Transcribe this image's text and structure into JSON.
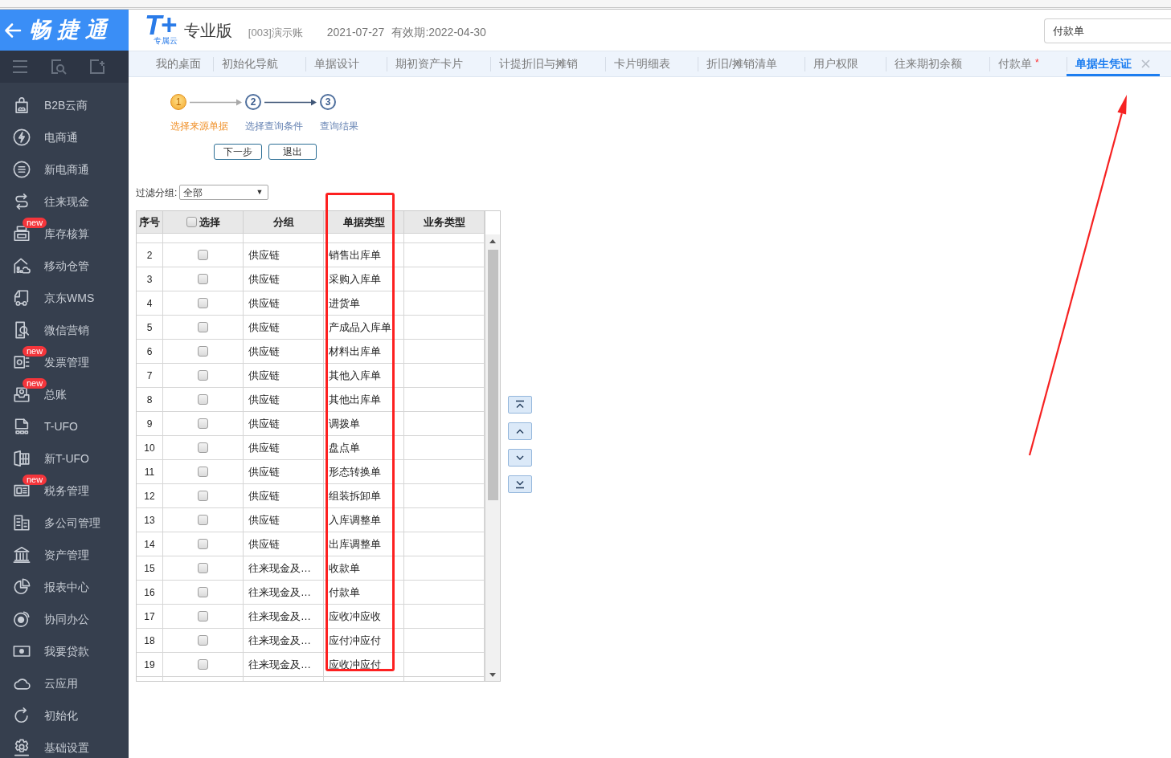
{
  "sidebar": {
    "brand": "畅捷通",
    "items": [
      {
        "label": "B2B云商"
      },
      {
        "label": "电商通"
      },
      {
        "label": "新电商通"
      },
      {
        "label": "往来现金"
      },
      {
        "label": "库存核算",
        "badge": "new"
      },
      {
        "label": "移动仓管"
      },
      {
        "label": "京东WMS"
      },
      {
        "label": "微信营销"
      },
      {
        "label": "发票管理",
        "badge": "new"
      },
      {
        "label": "总账",
        "badge": "new"
      },
      {
        "label": "T-UFO"
      },
      {
        "label": "新T-UFO"
      },
      {
        "label": "税务管理",
        "badge": "new"
      },
      {
        "label": "多公司管理"
      },
      {
        "label": "资产管理"
      },
      {
        "label": "报表中心"
      },
      {
        "label": "协同办公"
      },
      {
        "label": "我要贷款"
      },
      {
        "label": "云应用"
      },
      {
        "label": "初始化"
      },
      {
        "label": "基础设置"
      }
    ]
  },
  "header": {
    "logo_mark": "T+",
    "logo_sub": "专属云",
    "edition": "专业版",
    "account": "[003]演示账",
    "date": "2021-07-27",
    "validity": "有效期:2022-04-30",
    "search": {
      "value": "付款单"
    }
  },
  "tabs": [
    {
      "label": "我的桌面",
      "selected": false,
      "closable": false
    },
    {
      "label": "初始化导航",
      "selected": false,
      "closable": false
    },
    {
      "label": "单据设计",
      "selected": false,
      "closable": false
    },
    {
      "label": "期初资产卡片",
      "selected": false,
      "closable": false
    },
    {
      "label": "计提折旧与摊销",
      "selected": false,
      "closable": false
    },
    {
      "label": "卡片明细表",
      "selected": false,
      "closable": false
    },
    {
      "label": "折旧/摊销清单",
      "selected": false,
      "closable": false
    },
    {
      "label": "用户权限",
      "selected": false,
      "closable": false
    },
    {
      "label": "往来期初余额",
      "selected": false,
      "closable": false
    },
    {
      "label": "付款单",
      "marker": "*",
      "selected": false,
      "closable": false
    },
    {
      "label": "单据生凭证",
      "selected": true,
      "closable": true
    }
  ],
  "wizard": {
    "steps": [
      {
        "number": "1",
        "label": "选择来源单据",
        "selected": true
      },
      {
        "number": "2",
        "label": "选择查询条件",
        "selected": false
      },
      {
        "number": "3",
        "label": "查询结果",
        "selected": false
      }
    ],
    "buttons": [
      "下一步",
      "退出"
    ]
  },
  "filter": {
    "label": "过滤分组:",
    "value": "全部",
    "caret": "▼"
  },
  "table": {
    "columns": [
      "序号",
      "选择",
      "分组",
      "单据类型",
      "业务类型"
    ],
    "select_all": {
      "checked": false
    },
    "rows": [
      {
        "no": "2",
        "checked": false,
        "group": "供应链",
        "doc_type": "销售出库单"
      },
      {
        "no": "3",
        "checked": false,
        "group": "供应链",
        "doc_type": "采购入库单"
      },
      {
        "no": "4",
        "checked": false,
        "group": "供应链",
        "doc_type": "进货单"
      },
      {
        "no": "5",
        "checked": false,
        "group": "供应链",
        "doc_type": "产成品入库单"
      },
      {
        "no": "6",
        "checked": false,
        "group": "供应链",
        "doc_type": "材料出库单"
      },
      {
        "no": "7",
        "checked": false,
        "group": "供应链",
        "doc_type": "其他入库单"
      },
      {
        "no": "8",
        "checked": false,
        "group": "供应链",
        "doc_type": "其他出库单"
      },
      {
        "no": "9",
        "checked": false,
        "group": "供应链",
        "doc_type": "调拨单"
      },
      {
        "no": "10",
        "checked": false,
        "group": "供应链",
        "doc_type": "盘点单"
      },
      {
        "no": "11",
        "checked": false,
        "group": "供应链",
        "doc_type": "形态转换单"
      },
      {
        "no": "12",
        "checked": false,
        "group": "供应链",
        "doc_type": "组装拆卸单"
      },
      {
        "no": "13",
        "checked": false,
        "group": "供应链",
        "doc_type": "入库调整单"
      },
      {
        "no": "14",
        "checked": false,
        "group": "供应链",
        "doc_type": "出库调整单"
      },
      {
        "no": "15",
        "checked": false,
        "group": "往来现金及…",
        "doc_type": "收款单"
      },
      {
        "no": "16",
        "checked": false,
        "group": "往来现金及…",
        "doc_type": "付款单"
      },
      {
        "no": "17",
        "checked": false,
        "group": "往来现金及…",
        "doc_type": "应收冲应收"
      },
      {
        "no": "18",
        "checked": false,
        "group": "往来现金及…",
        "doc_type": "应付冲应付"
      },
      {
        "no": "19",
        "checked": false,
        "group": "往来现金及…",
        "doc_type": "应收冲应付"
      }
    ]
  },
  "annotations": [
    {
      "kind": "rectangle"
    },
    {
      "kind": "arrow"
    }
  ]
}
